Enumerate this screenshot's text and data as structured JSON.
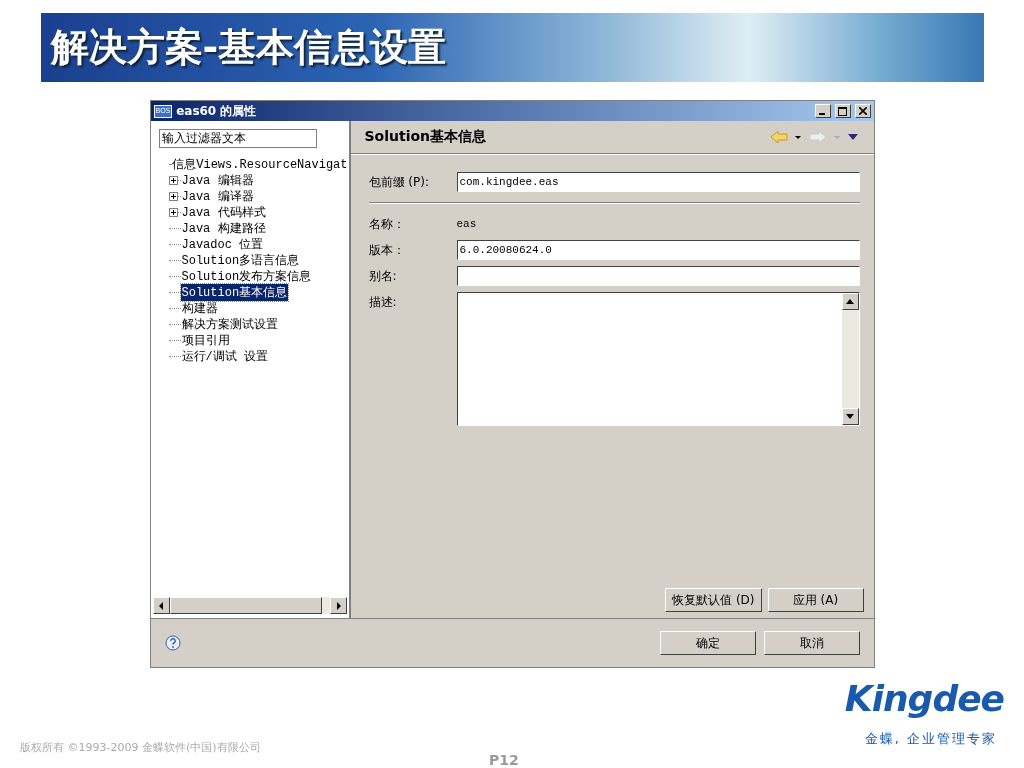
{
  "slide": {
    "title": "解决方案-基本信息设置",
    "copyright": "版权所有 ©1993-2009 金蝶软件(中国)有限公司",
    "page": "P12",
    "logo": "Kingdee",
    "tagline": "金蝶, 企业管理专家"
  },
  "window": {
    "title": "eas60 的属性",
    "app_badge": "BOS"
  },
  "filter": {
    "value": "输入过滤器文本"
  },
  "tree": [
    {
      "label": "信息Views.ResourceNavigat",
      "kind": "leaf",
      "selected": false
    },
    {
      "label": "Java 编辑器",
      "kind": "folder",
      "expanded": false,
      "selected": false
    },
    {
      "label": "Java 编译器",
      "kind": "folder",
      "expanded": false,
      "selected": false
    },
    {
      "label": "Java 代码样式",
      "kind": "folder",
      "expanded": false,
      "selected": false
    },
    {
      "label": "Java 构建路径",
      "kind": "leaf",
      "selected": false
    },
    {
      "label": "Javadoc 位置",
      "kind": "leaf",
      "selected": false
    },
    {
      "label": "Solution多语言信息",
      "kind": "leaf",
      "selected": false
    },
    {
      "label": "Solution发布方案信息",
      "kind": "leaf",
      "selected": false
    },
    {
      "label": "Solution基本信息",
      "kind": "leaf",
      "selected": true
    },
    {
      "label": "构建器",
      "kind": "leaf",
      "selected": false
    },
    {
      "label": "解决方案测试设置",
      "kind": "leaf",
      "selected": false
    },
    {
      "label": "项目引用",
      "kind": "leaf",
      "selected": false
    },
    {
      "label": "运行/调试 设置",
      "kind": "leaf",
      "selected": false
    }
  ],
  "page": {
    "title": "Solution基本信息",
    "fields": [
      {
        "kind": "input",
        "label": "包前缀 (P):",
        "value": "com.kingdee.eas"
      },
      {
        "kind": "separator"
      },
      {
        "kind": "text",
        "label": "名称：",
        "value": "eas"
      },
      {
        "kind": "input",
        "label": "版本：",
        "value": "6.0.20080624.0"
      },
      {
        "kind": "input",
        "label": "别名:"
      },
      {
        "kind": "textarea",
        "label": "描述:"
      }
    ],
    "buttons": [
      "恢复默认值 (D)",
      "应用 (A)"
    ]
  },
  "footer_buttons": [
    "确定",
    "取消"
  ]
}
